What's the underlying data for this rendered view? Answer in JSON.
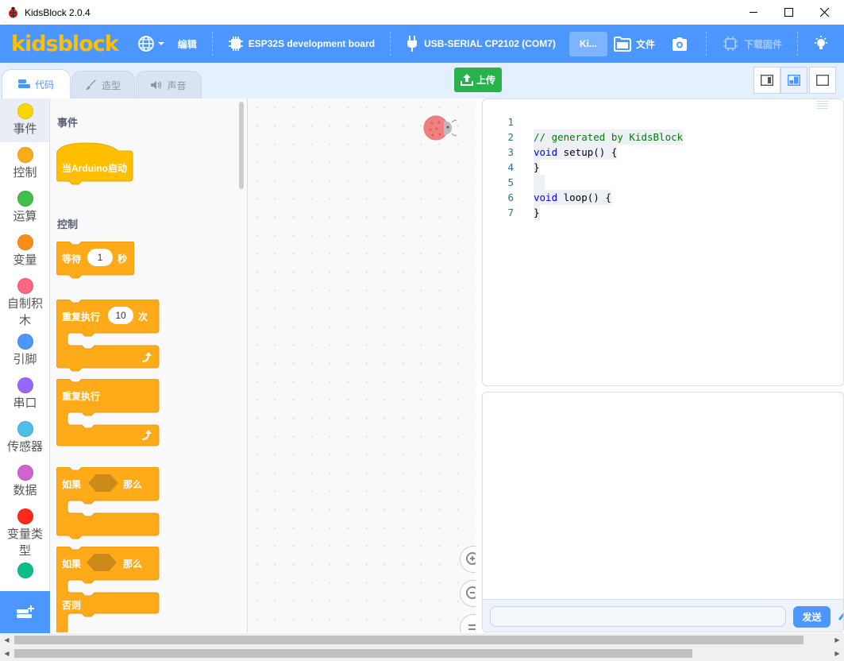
{
  "window": {
    "title": "KidsBlock 2.0.4",
    "controls": [
      "minimize",
      "maximize",
      "close"
    ]
  },
  "menubar": {
    "logo": "kidsblock",
    "edit_label": "编辑",
    "board_label": "ESP32S development board",
    "port_label": "USB-SERIAL CP2102 (COM7)",
    "kid_label": "Ki...",
    "file_label": "文件",
    "download_label": "下载固件"
  },
  "tabs": [
    {
      "label": "代码",
      "active": true
    },
    {
      "label": "造型",
      "active": false
    },
    {
      "label": "声音",
      "active": false
    }
  ],
  "toolbar": {
    "upload_label": "上传"
  },
  "categories": [
    {
      "label": "事件",
      "color": "#ffd500"
    },
    {
      "label": "控制",
      "color": "#ffab19"
    },
    {
      "label": "运算",
      "color": "#40bf4a"
    },
    {
      "label": "变量",
      "color": "#ff8c1a"
    },
    {
      "label": "自制积木",
      "color": "#ff6680"
    },
    {
      "label": "引脚",
      "color": "#4c97ff"
    },
    {
      "label": "串口",
      "color": "#9966ff"
    },
    {
      "label": "传感器",
      "color": "#4cbfe6"
    },
    {
      "label": "数据",
      "color": "#cf63cf"
    },
    {
      "label": "变量类型",
      "color": "#ff2a1a"
    },
    {
      "label": "",
      "color": "#0fbd8c"
    }
  ],
  "palette": {
    "events_heading": "事件",
    "control_heading": "控制",
    "block_when_start": "当Arduino启动",
    "wait": {
      "before": "等待",
      "value": "1",
      "after": "秒"
    },
    "repeat": {
      "before": "重复执行",
      "value": "10",
      "after": "次"
    },
    "forever": "重复执行",
    "if_then": {
      "if": "如果",
      "then": "那么"
    },
    "if_else": {
      "if": "如果",
      "then": "那么",
      "else": "否则"
    }
  },
  "code": {
    "lines": [
      {
        "n": "1",
        "text": "// generated by KidsBlock",
        "kind": "comment"
      },
      {
        "n": "2",
        "text": "void setup() {",
        "kind": "code"
      },
      {
        "n": "3",
        "text": "}",
        "kind": "code"
      },
      {
        "n": "4",
        "text": "",
        "kind": "code"
      },
      {
        "n": "5",
        "text": "void loop() {",
        "kind": "code"
      },
      {
        "n": "6",
        "text": "}",
        "kind": "code"
      },
      {
        "n": "7",
        "text": "",
        "kind": "code"
      }
    ]
  },
  "serial": {
    "input_value": "",
    "send_label": "发送"
  },
  "colors": {
    "brand_blue": "#4c97ff",
    "logo_yellow": "#ffbf00",
    "upload_green": "#28b24b",
    "control_orange": "#ffab19",
    "event_yellow": "#ffbf00",
    "comment_green": "#008000",
    "keyword_blue": "#0000ff",
    "line_number": "#237893"
  }
}
